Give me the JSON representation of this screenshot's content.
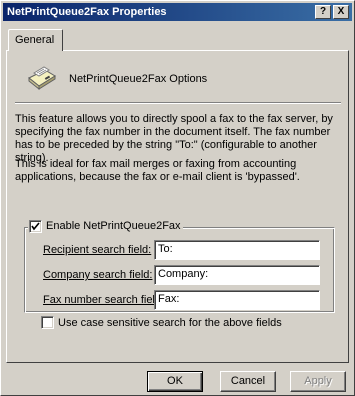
{
  "window": {
    "title": "NetPrintQueue2Fax Properties",
    "help_label": "?",
    "close_label": "X"
  },
  "tabs": [
    {
      "label": "General",
      "active": true
    }
  ],
  "header": {
    "icon": "fax-machine-icon",
    "title": "NetPrintQueue2Fax Options"
  },
  "description": {
    "paragraph1": "This feature allows you to directly spool a fax to the fax server, by specifying the fax number in the document itself. The fax number has to be preceded by the string \"To:\" (configurable to another string).",
    "paragraph2": "This is ideal for fax mail merges or faxing from accounting applications, because the fax or e-mail client is 'bypassed'."
  },
  "group": {
    "enable_label": "Enable NetPrintQueue2Fax",
    "enable_checked": true,
    "fields": [
      {
        "label": "Recipient search field:",
        "value": "To:"
      },
      {
        "label": "Company search field:",
        "value": "Company:"
      },
      {
        "label": "Fax number search field:",
        "value": "Fax:"
      }
    ],
    "case_sensitive_label": "Use case sensitive search for the above fields",
    "case_sensitive_checked": false
  },
  "buttons": {
    "ok": "OK",
    "cancel": "Cancel",
    "apply": "Apply",
    "apply_enabled": false
  }
}
